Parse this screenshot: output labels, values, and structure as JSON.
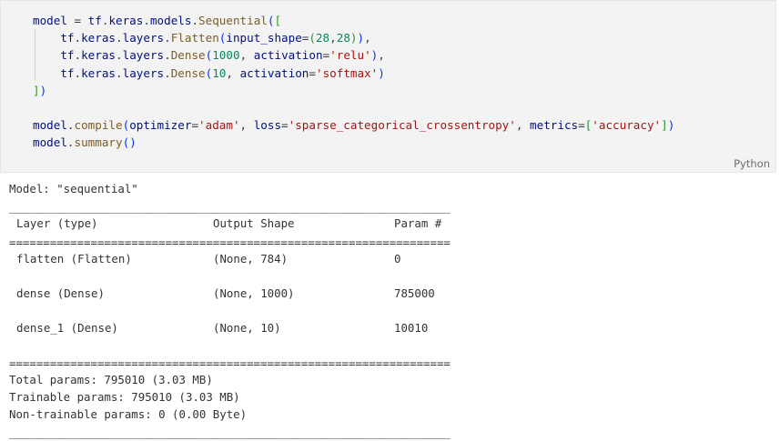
{
  "cell": {
    "language_label": "Python",
    "code_lines": [
      [
        {
          "t": "model",
          "c": "tok-var"
        },
        {
          "t": " = ",
          "c": "tok-punc"
        },
        {
          "t": "tf",
          "c": "tok-var"
        },
        {
          "t": ".",
          "c": "tok-punc"
        },
        {
          "t": "keras",
          "c": "tok-var"
        },
        {
          "t": ".",
          "c": "tok-punc"
        },
        {
          "t": "models",
          "c": "tok-var"
        },
        {
          "t": ".",
          "c": "tok-punc"
        },
        {
          "t": "Sequential",
          "c": "tok-fn"
        },
        {
          "t": "(",
          "c": "tok-bracket"
        },
        {
          "t": "[",
          "c": "tok-bracket2"
        }
      ],
      [
        {
          "t": "    tf",
          "c": "tok-var"
        },
        {
          "t": ".",
          "c": "tok-punc"
        },
        {
          "t": "keras",
          "c": "tok-var"
        },
        {
          "t": ".",
          "c": "tok-punc"
        },
        {
          "t": "layers",
          "c": "tok-var"
        },
        {
          "t": ".",
          "c": "tok-punc"
        },
        {
          "t": "Flatten",
          "c": "tok-fn"
        },
        {
          "t": "(",
          "c": "tok-bracket"
        },
        {
          "t": "input_shape",
          "c": "tok-param"
        },
        {
          "t": "=",
          "c": "tok-punc"
        },
        {
          "t": "(",
          "c": "tok-bracket2"
        },
        {
          "t": "28",
          "c": "tok-num"
        },
        {
          "t": ",",
          "c": "tok-punc"
        },
        {
          "t": "28",
          "c": "tok-num"
        },
        {
          "t": ")",
          "c": "tok-bracket2"
        },
        {
          "t": ")",
          "c": "tok-bracket"
        },
        {
          "t": ",",
          "c": "tok-punc"
        }
      ],
      [
        {
          "t": "    tf",
          "c": "tok-var"
        },
        {
          "t": ".",
          "c": "tok-punc"
        },
        {
          "t": "keras",
          "c": "tok-var"
        },
        {
          "t": ".",
          "c": "tok-punc"
        },
        {
          "t": "layers",
          "c": "tok-var"
        },
        {
          "t": ".",
          "c": "tok-punc"
        },
        {
          "t": "Dense",
          "c": "tok-fn"
        },
        {
          "t": "(",
          "c": "tok-bracket"
        },
        {
          "t": "1000",
          "c": "tok-num"
        },
        {
          "t": ", ",
          "c": "tok-punc"
        },
        {
          "t": "activation",
          "c": "tok-param"
        },
        {
          "t": "=",
          "c": "tok-punc"
        },
        {
          "t": "'relu'",
          "c": "tok-str"
        },
        {
          "t": ")",
          "c": "tok-bracket"
        },
        {
          "t": ",",
          "c": "tok-punc"
        }
      ],
      [
        {
          "t": "    tf",
          "c": "tok-var"
        },
        {
          "t": ".",
          "c": "tok-punc"
        },
        {
          "t": "keras",
          "c": "tok-var"
        },
        {
          "t": ".",
          "c": "tok-punc"
        },
        {
          "t": "layers",
          "c": "tok-var"
        },
        {
          "t": ".",
          "c": "tok-punc"
        },
        {
          "t": "Dense",
          "c": "tok-fn"
        },
        {
          "t": "(",
          "c": "tok-bracket"
        },
        {
          "t": "10",
          "c": "tok-num"
        },
        {
          "t": ", ",
          "c": "tok-punc"
        },
        {
          "t": "activation",
          "c": "tok-param"
        },
        {
          "t": "=",
          "c": "tok-punc"
        },
        {
          "t": "'softmax'",
          "c": "tok-str"
        },
        {
          "t": ")",
          "c": "tok-bracket"
        }
      ],
      [
        {
          "t": "]",
          "c": "tok-bracket2"
        },
        {
          "t": ")",
          "c": "tok-bracket"
        }
      ],
      [],
      [
        {
          "t": "model",
          "c": "tok-var"
        },
        {
          "t": ".",
          "c": "tok-punc"
        },
        {
          "t": "compile",
          "c": "tok-fn"
        },
        {
          "t": "(",
          "c": "tok-bracket"
        },
        {
          "t": "optimizer",
          "c": "tok-param"
        },
        {
          "t": "=",
          "c": "tok-punc"
        },
        {
          "t": "'adam'",
          "c": "tok-str"
        },
        {
          "t": ", ",
          "c": "tok-punc"
        },
        {
          "t": "loss",
          "c": "tok-param"
        },
        {
          "t": "=",
          "c": "tok-punc"
        },
        {
          "t": "'sparse_categorical_crossentropy'",
          "c": "tok-str"
        },
        {
          "t": ", ",
          "c": "tok-punc"
        },
        {
          "t": "metrics",
          "c": "tok-param"
        },
        {
          "t": "=",
          "c": "tok-punc"
        },
        {
          "t": "[",
          "c": "tok-bracket2"
        },
        {
          "t": "'accuracy'",
          "c": "tok-str"
        },
        {
          "t": "]",
          "c": "tok-bracket2"
        },
        {
          "t": ")",
          "c": "tok-bracket"
        }
      ],
      [
        {
          "t": "model",
          "c": "tok-var"
        },
        {
          "t": ".",
          "c": "tok-punc"
        },
        {
          "t": "summary",
          "c": "tok-fn"
        },
        {
          "t": "(",
          "c": "tok-bracket"
        },
        {
          "t": ")",
          "c": "tok-bracket"
        }
      ]
    ]
  },
  "output": {
    "model_title": "Model: \"sequential\"",
    "rule_underscore": "_________________________________________________________________",
    "rule_equals": "=================================================================",
    "header": {
      "layer": "Layer (type)",
      "output_shape": "Output Shape",
      "params": "Param #"
    },
    "rows": [
      {
        "layer": "flatten (Flatten)",
        "output_shape": "(None, 784)",
        "params": "0"
      },
      {
        "layer": "dense (Dense)",
        "output_shape": "(None, 1000)",
        "params": "785000"
      },
      {
        "layer": "dense_1 (Dense)",
        "output_shape": "(None, 10)",
        "params": "10010"
      }
    ],
    "totals": [
      "Total params: 795010 (3.03 MB)",
      "Trainable params: 795010 (3.03 MB)",
      "Non-trainable params: 0 (0.00 Byte)"
    ]
  }
}
